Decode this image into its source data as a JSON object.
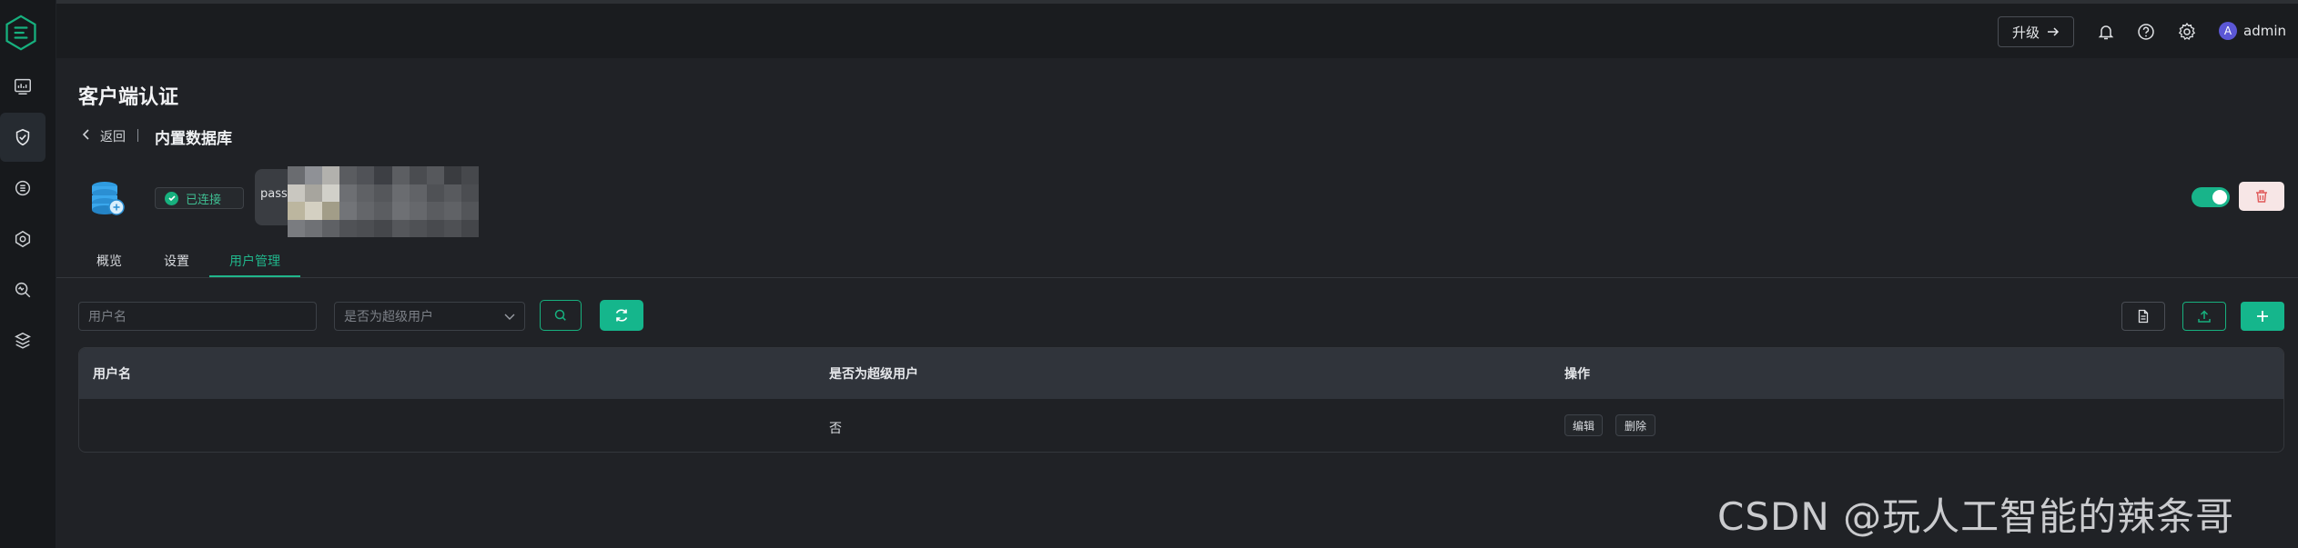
{
  "app": {
    "upgrade_label": "升级",
    "user_initial": "A",
    "user_name": "admin"
  },
  "page": {
    "title": "客户端认证",
    "back_label": "返回",
    "db_title": "内置数据库",
    "status": "已连接",
    "tooltip_text": "pass"
  },
  "tabs": [
    {
      "label": "概览"
    },
    {
      "label": "设置"
    },
    {
      "label": "用户管理"
    }
  ],
  "filters": {
    "username_placeholder": "用户名",
    "superuser_placeholder": "是否为超级用户"
  },
  "table": {
    "headers": [
      "用户名",
      "是否为超级用户",
      "操作"
    ],
    "rows": [
      {
        "username": "",
        "is_superuser": "否",
        "actions": [
          "编辑",
          "删除"
        ]
      }
    ]
  },
  "watermark": "CSDN @玩人工智能的辣条哥",
  "colors": {
    "accent": "#15b68c",
    "danger_bg": "#f7e6e6",
    "danger_icon": "#e05a5a"
  },
  "icons": {
    "sidebar": [
      "dashboard-icon",
      "shield-check-icon",
      "data-integration-icon",
      "rules-icon",
      "diagnose-icon",
      "plugins-icon"
    ],
    "header": [
      "bell-icon",
      "help-icon",
      "gear-icon"
    ]
  }
}
